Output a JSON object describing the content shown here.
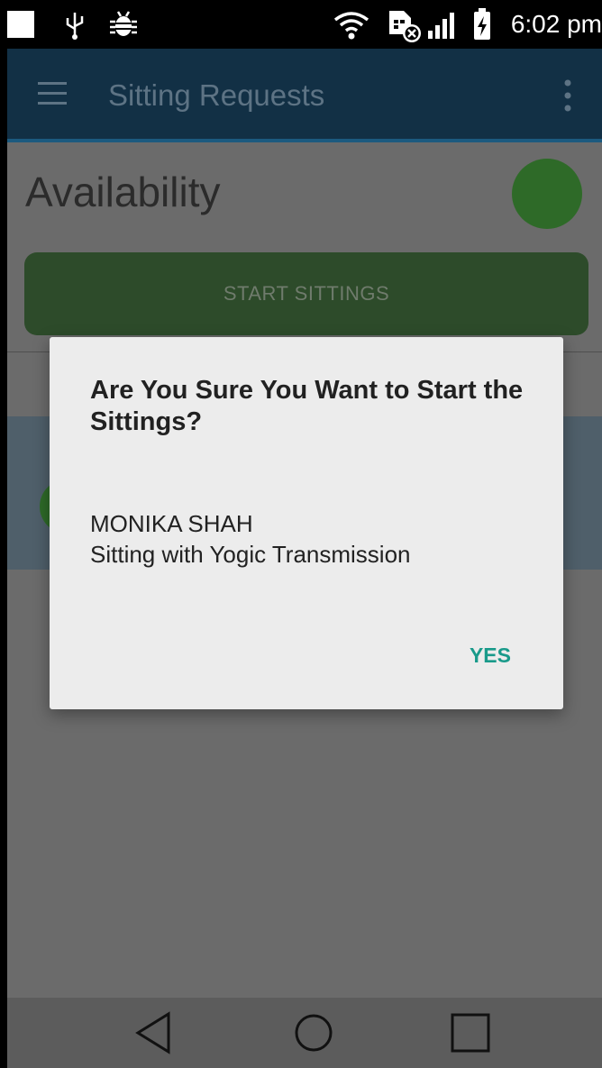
{
  "status_bar": {
    "time": "6:02 pm",
    "icons": [
      "notification-square-icon",
      "usb-icon",
      "debug-bug-icon",
      "wifi-icon",
      "no-sim-icon",
      "signal-icon",
      "battery-charging-icon"
    ]
  },
  "app_bar": {
    "title": "Sitting Requests",
    "menu_icon": "hamburger-menu-icon",
    "overflow_icon": "more-vert-icon"
  },
  "availability": {
    "label": "Availability",
    "status_color": "#2e6a28"
  },
  "start_button": {
    "label": "START SITTINGS"
  },
  "dialog": {
    "title": "Are You Sure You Want to Start the Sittings?",
    "name": "MONIKA SHAH",
    "subtitle": "Sitting with Yogic Transmission",
    "yes_label": "YES",
    "accent_color": "#199a8a"
  },
  "nav_bar": {
    "back_icon": "back-triangle-icon",
    "home_icon": "home-circle-icon",
    "recent_icon": "recent-apps-square-icon"
  }
}
